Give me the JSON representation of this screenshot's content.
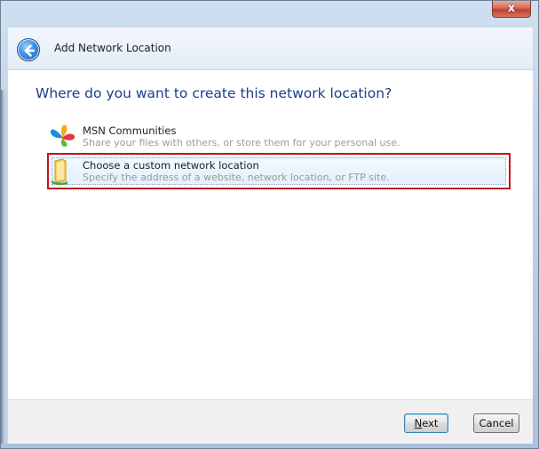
{
  "window": {
    "title": "Add Network Location",
    "close_label": "x"
  },
  "header": {
    "back_icon": "back-arrow-icon"
  },
  "main": {
    "question": "Where do you want to create this network location?",
    "options": [
      {
        "title": "MSN Communities",
        "description": "Share your files with others, or store them for your personal use.",
        "icon": "msn-butterfly-icon",
        "selected": false
      },
      {
        "title": "Choose a custom network location",
        "description": "Specify the address of a website, network location, or FTP site.",
        "icon": "folder-network-icon",
        "selected": true
      }
    ]
  },
  "footer": {
    "next_label": "Next",
    "cancel_label": "Cancel"
  },
  "colors": {
    "question_text": "#1a3f8a",
    "highlight_border": "#c0161e",
    "description_text": "#9a9a9a"
  }
}
